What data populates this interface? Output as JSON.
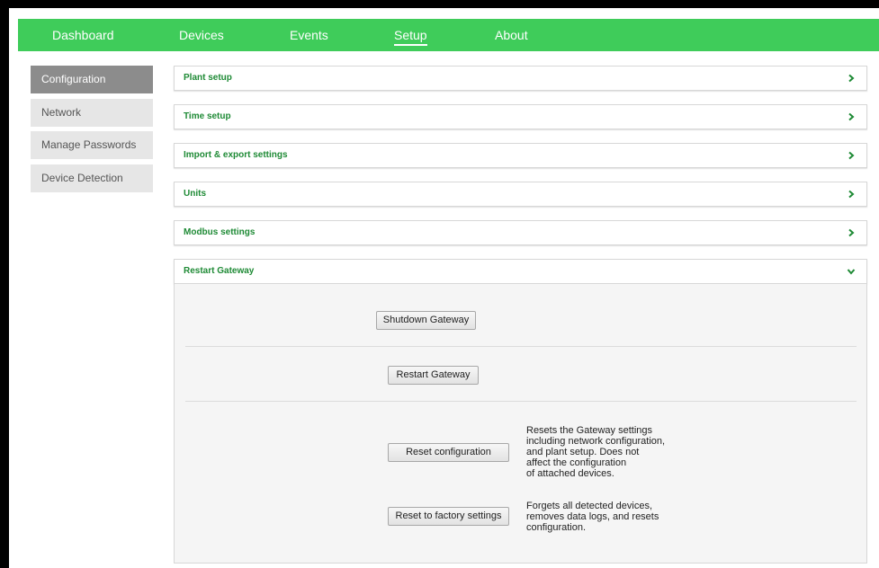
{
  "nav": {
    "items": [
      "Dashboard",
      "Devices",
      "Events",
      "Setup",
      "About"
    ],
    "active": "Setup"
  },
  "sidebar": {
    "items": [
      "Configuration",
      "Network",
      "Manage Passwords",
      "Device Detection"
    ],
    "active": "Configuration"
  },
  "panels": {
    "plant": "Plant setup",
    "time": "Time setup",
    "import_export": "Import & export settings",
    "units": "Units",
    "modbus": "Modbus settings",
    "restart": "Restart Gateway"
  },
  "actions": {
    "shutdown_label": "Shutdown Gateway",
    "restart_label": "Restart Gateway",
    "reset_config_label": "Reset configuration",
    "reset_config_desc": "Resets the Gateway settings\nincluding network configuration,\nand plant setup. Does not\naffect the configuration\nof attached devices.",
    "factory_label": "Reset to factory settings",
    "factory_desc": "Forgets all detected devices,\nremoves data logs, and resets\nconfiguration."
  },
  "colors": {
    "accent": "#3fcc5a",
    "panel_title": "#1e8a35",
    "sidebar_active": "#8c8c8c"
  }
}
